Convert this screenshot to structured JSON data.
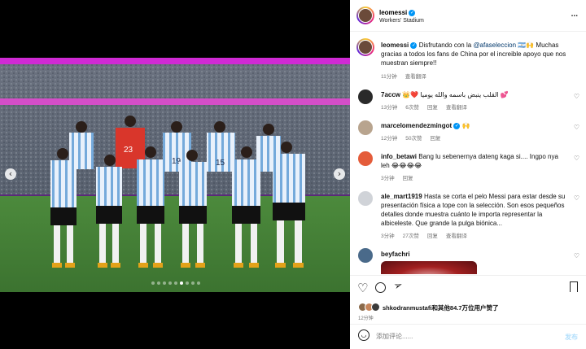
{
  "post": {
    "username": "leomessi",
    "location": "Workers' Stadium",
    "more": "...",
    "caption_user": "leomessi",
    "caption_text_1": "Disfrutando con la",
    "caption_mention": "@afaseleccion",
    "caption_text_2": "🇦🇷🙌 Muchas gracias a todos los fans de China por el increible apoyo que nos muestran siempre!!",
    "caption_time": "11分钟",
    "see_translation": "查看翻译"
  },
  "comments": [
    {
      "user": "7accw",
      "badge": "👑❤️",
      "text": "القلب ينبض باسمه والله يوميا 💕",
      "time": "13分钟",
      "likes": "6次赞",
      "reply": "回复",
      "translate": "查看翻译"
    },
    {
      "user": "marcelomendezmingot",
      "badge": "🙌",
      "text": "",
      "time": "12分钟",
      "likes": "50次赞",
      "reply": "回复",
      "translate": ""
    },
    {
      "user": "info_betawi",
      "badge": "",
      "text": "Bang lu sebenernya dateng kaga si.... Ingpo nya leh 😂😂😂😂",
      "time": "3分钟",
      "likes": "",
      "reply": "回复",
      "translate": ""
    },
    {
      "user": "ale_mart1919",
      "badge": "",
      "text": "Hasta se corta el pelo Messi para estar desde su presentación física a tope con la selección. Son esos pequeños detalles donde muestra cuánto le importa representar la albiceleste. Que grande la pulga biónica...",
      "time": "3分钟",
      "likes": "27次赞",
      "reply": "回复",
      "translate": "查看翻译"
    },
    {
      "user": "beyfachri",
      "badge": "",
      "text": "",
      "time": "",
      "likes": "",
      "reply": "",
      "translate": ""
    }
  ],
  "actions": {
    "liked_by_user": "shkodranmustafi",
    "liked_by_rest": "和其他84.7万位用户赞了",
    "post_time": "12分钟",
    "comment_placeholder": "添加评论......",
    "post_button": "发布"
  },
  "icons": {
    "heart": "heart-icon",
    "comment": "comment-icon",
    "share": "share-icon",
    "save": "save-icon",
    "emoji": "emoji-icon"
  },
  "carousel": {
    "count": 9,
    "active_index": 5
  },
  "colors": {
    "verified": "#0095f6",
    "post_button": "#b2dffc",
    "pitch": "#3f7d33",
    "jersey": "#75aadb",
    "keeper": "#d9362b"
  }
}
